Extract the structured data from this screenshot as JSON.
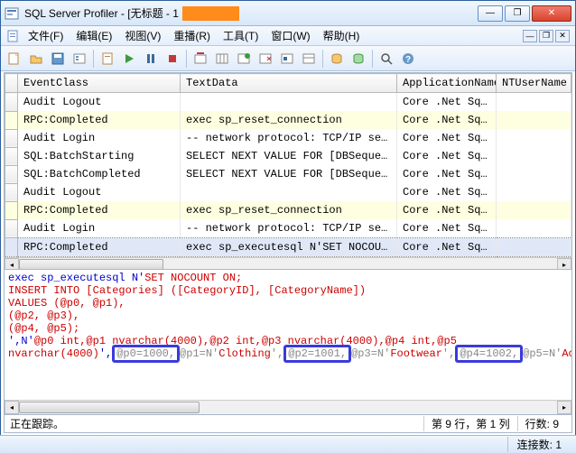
{
  "window": {
    "title": "SQL Server Profiler - [无标题 - 1",
    "min": "—",
    "max": "❐",
    "close": "✕"
  },
  "menu": {
    "icon": "profiler-doc-icon",
    "items": [
      "文件(F)",
      "编辑(E)",
      "视图(V)",
      "重播(R)",
      "工具(T)",
      "窗口(W)",
      "帮助(H)"
    ]
  },
  "toolbar": {
    "buttons": [
      "new-trace-icon",
      "open-icon",
      "save-icon",
      "properties-icon",
      "|",
      "template-icon",
      "run-icon",
      "pause-icon",
      "stop-icon",
      "|",
      "clear-icon",
      "columns-icon",
      "bookmark-icon",
      "toggle-icon",
      "filter-icon",
      "organize-icon",
      "|",
      "ssms-icon",
      "dta-icon",
      "|",
      "find-icon",
      "help-icon"
    ]
  },
  "grid": {
    "columns": [
      "EventClass",
      "TextData",
      "ApplicationName",
      "NTUserName"
    ],
    "rows": [
      {
        "hl": false,
        "c": [
          "Audit Logout",
          "",
          "Core .Net Sq...",
          ""
        ]
      },
      {
        "hl": true,
        "c": [
          "RPC:Completed",
          "exec sp_reset_connection",
          "Core .Net Sq...",
          ""
        ]
      },
      {
        "hl": false,
        "c": [
          "Audit Login",
          "-- network protocol: TCP/IP  set qu...",
          "Core .Net Sq...",
          ""
        ]
      },
      {
        "hl": false,
        "c": [
          "SQL:BatchStarting",
          "SELECT NEXT VALUE FOR [DBSequenceHiLo]",
          "Core .Net Sq...",
          ""
        ]
      },
      {
        "hl": false,
        "c": [
          "SQL:BatchCompleted",
          "SELECT NEXT VALUE FOR [DBSequenceHiLo]",
          "Core .Net Sq...",
          ""
        ]
      },
      {
        "hl": false,
        "c": [
          "Audit Logout",
          "",
          "Core .Net Sq...",
          ""
        ]
      },
      {
        "hl": true,
        "c": [
          "RPC:Completed",
          "exec sp_reset_connection",
          "Core .Net Sq...",
          ""
        ]
      },
      {
        "hl": false,
        "c": [
          "Audit Login",
          "-- network protocol: TCP/IP  set qu...",
          "Core .Net Sq...",
          ""
        ]
      },
      {
        "hl": true,
        "sel": true,
        "c": [
          "RPC:Completed",
          "exec sp_executesql N'SET NOCOUNT ON...",
          "Core .Net Sq...",
          ""
        ]
      }
    ]
  },
  "code": {
    "l1a": "exec sp_executesql N'",
    "l1b": "SET NOCOUNT ON;",
    "l2": "INSERT INTO [Categories] ([CategoryID], [CategoryName])",
    "l3": "VALUES (@p0, @p1),",
    "l4": "(@p2, @p3),",
    "l5": "(@p4, @p5);",
    "l6a": "',N'",
    "l6b": "@p0 int,@p1 nvarchar(4000),@p2 int,@p3 nvarchar(4000),@p4 int,@p5",
    "l7a": "nvarchar(4000)",
    "l7b": "',",
    "h1": "@p0=1000,",
    "l7c": "@p1=N'",
    "l7d": "Clothing",
    "l7e": "',",
    "h2": "@p2=1001,",
    "l7f": "@p3=N'",
    "l7g": "Footwear",
    "l7h": "',",
    "h3": "@p4=1002,",
    "l7i": "@p5=N'",
    "l7j": "Accessories",
    "l7k": "'"
  },
  "status": {
    "tracking": "正在跟踪。",
    "pos": "第 9 行，第 1 列",
    "rows": "行数: 9"
  },
  "winstat": {
    "conn": "连接数: 1"
  }
}
